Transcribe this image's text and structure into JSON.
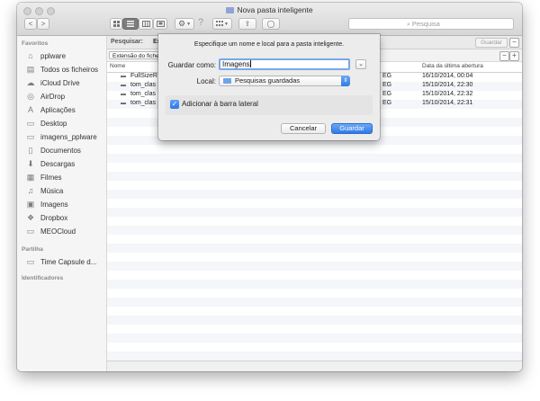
{
  "window": {
    "title": "Nova pasta inteligente"
  },
  "toolbar": {
    "back_label": "<",
    "forward_label": ">",
    "share_label": "⇪",
    "tag_label": "◯",
    "search_placeholder": "Pesquisa"
  },
  "sidebar": {
    "sections": [
      {
        "title": "Favoritos",
        "items": [
          {
            "label": "pplware",
            "icon": "house-icon"
          },
          {
            "label": "Todos os ficheiros",
            "icon": "all-files-icon"
          },
          {
            "label": "iCloud Drive",
            "icon": "cloud-icon"
          },
          {
            "label": "AirDrop",
            "icon": "airdrop-icon"
          },
          {
            "label": "Aplicações",
            "icon": "applications-icon"
          },
          {
            "label": "Desktop",
            "icon": "desktop-icon"
          },
          {
            "label": "imagens_pplware",
            "icon": "folder-icon"
          },
          {
            "label": "Documentos",
            "icon": "documents-icon"
          },
          {
            "label": "Descargas",
            "icon": "downloads-icon"
          },
          {
            "label": "Filmes",
            "icon": "movies-icon"
          },
          {
            "label": "Música",
            "icon": "music-icon"
          },
          {
            "label": "Imagens",
            "icon": "pictures-icon"
          },
          {
            "label": "Dropbox",
            "icon": "dropbox-icon"
          },
          {
            "label": "MEOCloud",
            "icon": "folder-icon"
          }
        ]
      },
      {
        "title": "Partilha",
        "items": [
          {
            "label": "Time Capsule d...",
            "icon": "time-capsule-icon"
          }
        ]
      },
      {
        "title": "Identificadores",
        "items": []
      }
    ]
  },
  "search_bar": {
    "label": "Pesquisar:",
    "scope": "Es",
    "save_label": "Guardar",
    "remove_label": "−",
    "add_label": "+"
  },
  "filter": {
    "criterion": "Extensão do fiche"
  },
  "table": {
    "columns": {
      "name": "Nome",
      "last_opened": "Data da última abertura"
    },
    "rows": [
      {
        "name": "FullSizeR",
        "kind": "EG",
        "last_opened": "16/10/2014, 00:04"
      },
      {
        "name": "tom_clas",
        "kind": "EG",
        "last_opened": "15/10/2014, 22:30"
      },
      {
        "name": "tom_clas",
        "kind": "EG",
        "last_opened": "15/10/2014, 22:32"
      },
      {
        "name": "tom_clas",
        "kind": "EG",
        "last_opened": "15/10/2014, 22:31"
      }
    ]
  },
  "dialog": {
    "prompt": "Especifique um nome e local para a pasta inteligente.",
    "name_label": "Guardar como:",
    "name_value": "Imagens",
    "location_label": "Local:",
    "location_value": "Pesquisas guardadas",
    "checkbox_label": "Adicionar à barra lateral",
    "checkbox_checked": true,
    "cancel_label": "Cancelar",
    "save_label": "Guardar"
  },
  "colors": {
    "accent": "#3b82ec",
    "sidebar_bg": "#f5f5f5",
    "row_alt": "#f4f6f9"
  }
}
